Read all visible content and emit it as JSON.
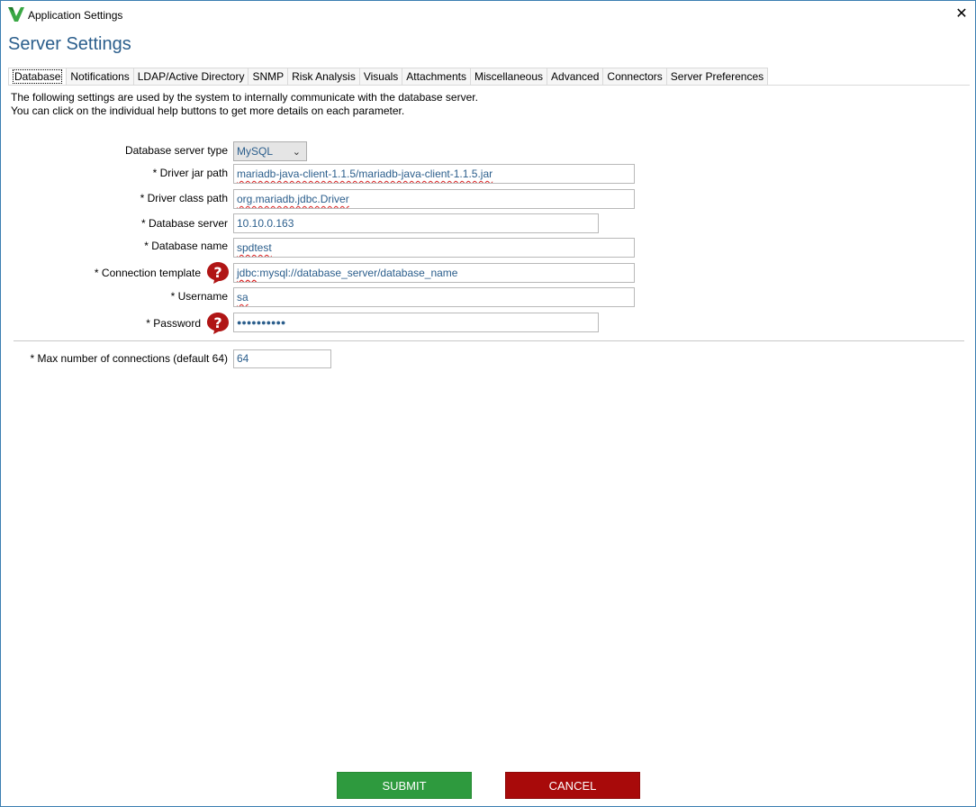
{
  "window": {
    "title": "Application Settings",
    "close_glyph": "✕"
  },
  "page": {
    "title": "Server Settings"
  },
  "tabs": [
    {
      "label": "Database",
      "active": true
    },
    {
      "label": "Notifications"
    },
    {
      "label": "LDAP/Active Directory"
    },
    {
      "label": "SNMP"
    },
    {
      "label": "Risk Analysis"
    },
    {
      "label": "Visuals"
    },
    {
      "label": "Attachments"
    },
    {
      "label": "Miscellaneous"
    },
    {
      "label": "Advanced"
    },
    {
      "label": "Connectors"
    },
    {
      "label": "Server Preferences"
    }
  ],
  "intro": {
    "line1": "The following settings are used by the system to internally communicate with the database server.",
    "line2": "You can click on the individual help buttons to get more details on each parameter."
  },
  "form": {
    "db_type": {
      "label": "Database server type",
      "value": "MySQL"
    },
    "driver_jar": {
      "label": "* Driver jar path",
      "value": "mariadb-java-client-1.1.5/mariadb-java-client-1.1.5.jar"
    },
    "driver_class": {
      "label": "* Driver class path",
      "value": "org.mariadb.jdbc.Driver"
    },
    "db_server": {
      "label": "* Database server",
      "value": "10.10.0.163"
    },
    "db_name": {
      "label": "* Database name",
      "value": "spdtest"
    },
    "conn_template": {
      "label": "* Connection template",
      "value_prefix": "jdbc",
      "value_rest": ":mysql://database_server/database_name"
    },
    "username": {
      "label": "* Username",
      "value": "sa"
    },
    "password": {
      "label": "* Password",
      "value": "●●●●●●●●●●"
    },
    "max_conn": {
      "label": "* Max number of connections (default 64)",
      "value": "64"
    }
  },
  "buttons": {
    "submit": "SUBMIT",
    "cancel": "CANCEL"
  },
  "icons": {
    "help": "help-icon",
    "logo": "app-logo-icon",
    "close": "close-icon",
    "dropdown": "chevron-down-icon"
  },
  "colors": {
    "accent": "#2b5e8c",
    "submit": "#2e9a3e",
    "cancel": "#a80a0a",
    "help_icon": "#b01515"
  }
}
